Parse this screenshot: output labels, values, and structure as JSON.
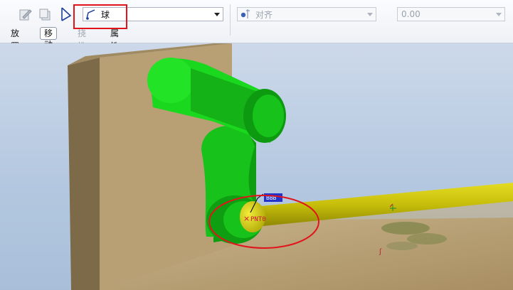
{
  "toolbar": {
    "buttons": [
      {
        "name": "edit-icon",
        "enabled": false
      },
      {
        "name": "copy-icon",
        "enabled": false
      },
      {
        "name": "connection-type-icon",
        "enabled": true
      }
    ],
    "connection_type": {
      "value": "球",
      "icon": "ball-joint-icon"
    },
    "constraint_type": {
      "value": "对齐",
      "icon": "align-icon",
      "enabled": false
    },
    "offset": {
      "value": "0.00",
      "enabled": false
    }
  },
  "tabs": [
    {
      "label": "放置",
      "active": false,
      "enabled": true
    },
    {
      "label": "移动",
      "active": true,
      "enabled": true
    },
    {
      "label": "挠性",
      "active": false,
      "enabled": false
    },
    {
      "label": "属性",
      "active": false,
      "enabled": true
    }
  ],
  "viewport": {
    "annotation_label": "PNT0",
    "marker_label": "BBB",
    "colors": {
      "part_green": "#17c21a",
      "part_yellow": "#c6be0a",
      "base_tan": "#b89f74",
      "highlight_red": "#e1141c"
    }
  }
}
